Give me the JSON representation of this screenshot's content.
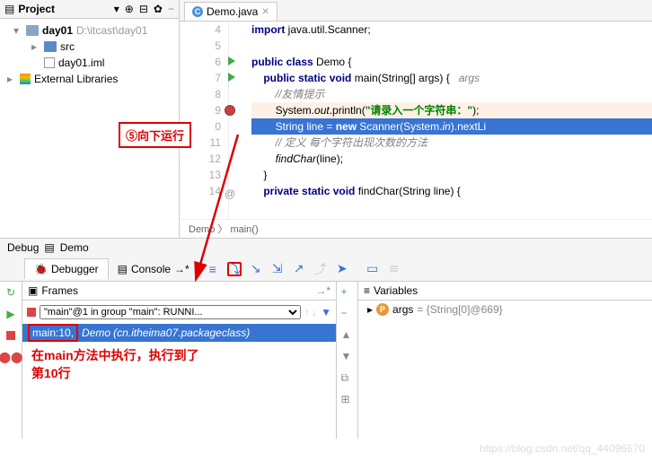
{
  "project": {
    "header": "Project",
    "root": "day01",
    "root_path": "D:\\itcast\\day01",
    "src": "src",
    "iml": "day01.iml",
    "libs": "External Libraries"
  },
  "tab": {
    "file": "Demo.java"
  },
  "gutter": [
    "4",
    "5",
    "6",
    "7",
    "8",
    "9",
    "0",
    "11",
    "12",
    "13",
    "14"
  ],
  "code": {
    "l4": "import java.util.Scanner;",
    "l6a": "public class",
    "l6b": " Demo {",
    "l7a": "public static void",
    "l7b": " main(String[] args) {",
    "l7c": "   args",
    "l8": "//友情提示",
    "l9a": "System.",
    "l9b": "out",
    "l9c": ".println(",
    "l9d": "\"请录入一个字符串：\"",
    "l9e": ");",
    "l10a": "String line = ",
    "l10b": "new",
    "l10c": " Scanner(System.",
    "l10d": "in",
    "l10e": ").nextLi",
    "l11": "// 定义 每个字符出现次数的方法",
    "l12a": "findChar",
    "l12b": "(line);",
    "l13": "}",
    "l14a": "private static void",
    "l14b": " findChar(String line) {"
  },
  "breadcrumb": "Demo 〉 main()",
  "callout1": "⑤向下运行",
  "debug": {
    "title": "Debug",
    "target": "Demo",
    "tab_debugger": "Debugger",
    "tab_console": "Console",
    "frames_hdr": "Frames",
    "vars_hdr": "Variables",
    "thread": "\"main\"@1 in group \"main\": RUNNI...",
    "frame_loc": "main:10,",
    "frame_cls": "Demo",
    "frame_pkg": "(cn.itheima07.packageclass)",
    "callout2": "在main方法中执行，执行到了\n第10行",
    "var_name": "args",
    "var_val": " = {String[0]@669}"
  },
  "watermark": "https://blog.csdn.net/qq_44096670"
}
